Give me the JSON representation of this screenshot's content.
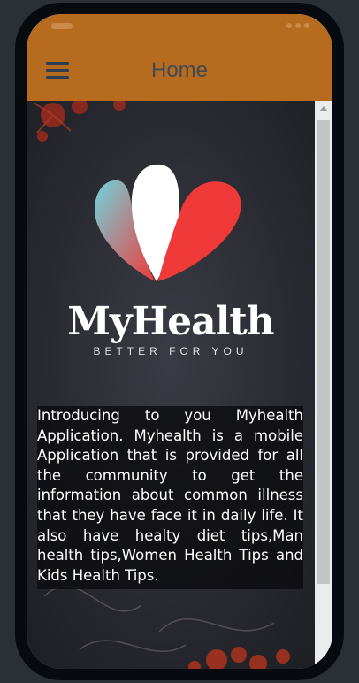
{
  "app": {
    "title": "Home"
  },
  "brand": {
    "name": "MyHealth",
    "tagline": "BETTER FOR YOU",
    "logo_colors": [
      "#6fd3dc",
      "#ffffff",
      "#f03a3a"
    ]
  },
  "intro": {
    "text": "Introducing to you Myhealth Application. Myhealth is a mobile Application that is provided for all the community to get the information about common illness that they have face it in daily life. It also have healty diet tips,Man health tips,Women Health Tips and Kids Health Tips."
  },
  "colors": {
    "app_bar": "#b76b1f",
    "background": "#2a2b32"
  },
  "icons": {
    "menu": "menu-icon"
  }
}
